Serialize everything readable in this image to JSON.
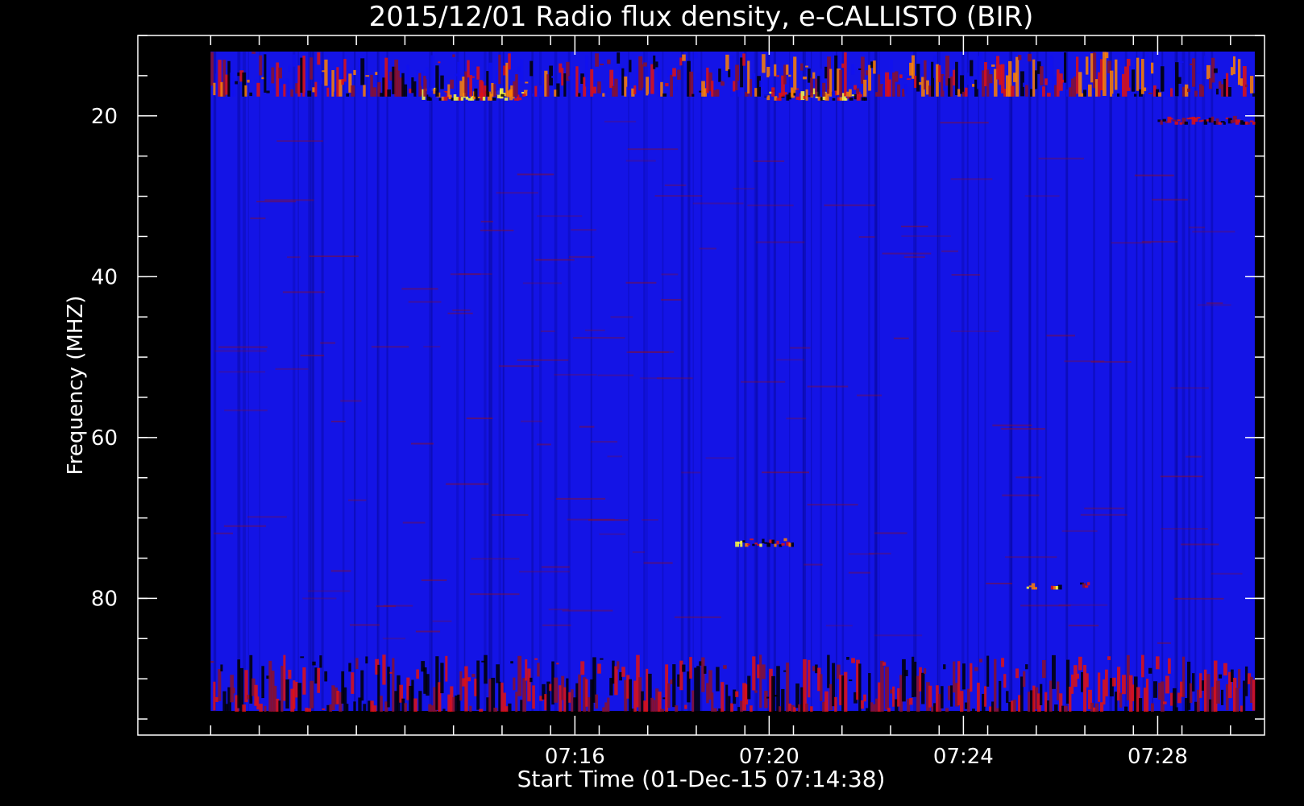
{
  "chart_data": {
    "type": "heatmap",
    "title": "2015/12/01  Radio flux density, e-CALLISTO (BIR)",
    "xlabel": "Start Time (01-Dec-15 07:14:38)",
    "ylabel": "Frequency (MHZ)",
    "x_ticks": [
      "07:16",
      "07:20",
      "07:24",
      "07:28"
    ],
    "y_ticks": [
      "20",
      "40",
      "60",
      "80"
    ],
    "xlim_minutes": [
      7.0,
      30.2
    ],
    "ylim_mhz": [
      10,
      97
    ],
    "data_extent": {
      "minutes": [
        8.5,
        30.0
      ],
      "mhz": [
        12,
        94
      ]
    },
    "colormap": [
      "#000000",
      "#1010ee",
      "#8a0f2a",
      "#e01010",
      "#ff8000",
      "#ffff40"
    ],
    "background_color": "#1414e6",
    "events": [
      {
        "minutes": [
          19.9,
          22.0
        ],
        "mhz": [
          16.5,
          18.0
        ],
        "level": "bright"
      },
      {
        "minutes": [
          12.8,
          15.0
        ],
        "mhz": [
          16.5,
          18.0
        ],
        "level": "bright"
      },
      {
        "minutes": [
          8.5,
          30.0
        ],
        "mhz": [
          12,
          17.5
        ],
        "level": "mixed"
      },
      {
        "minutes": [
          28.0,
          30.0
        ],
        "mhz": [
          20.0,
          21.0
        ],
        "level": "red"
      },
      {
        "minutes": [
          19.3,
          20.5
        ],
        "mhz": [
          72.5,
          73.5
        ],
        "level": "bright"
      },
      {
        "minutes": [
          25.3,
          25.5
        ],
        "mhz": [
          77.8,
          78.8
        ],
        "level": "bright"
      },
      {
        "minutes": [
          25.8,
          26.0
        ],
        "mhz": [
          77.8,
          78.8
        ],
        "level": "bright"
      },
      {
        "minutes": [
          26.4,
          26.6
        ],
        "mhz": [
          77.8,
          78.8
        ],
        "level": "red"
      },
      {
        "minutes": [
          8.5,
          30.0
        ],
        "mhz": [
          87,
          94
        ],
        "level": "red"
      }
    ]
  }
}
